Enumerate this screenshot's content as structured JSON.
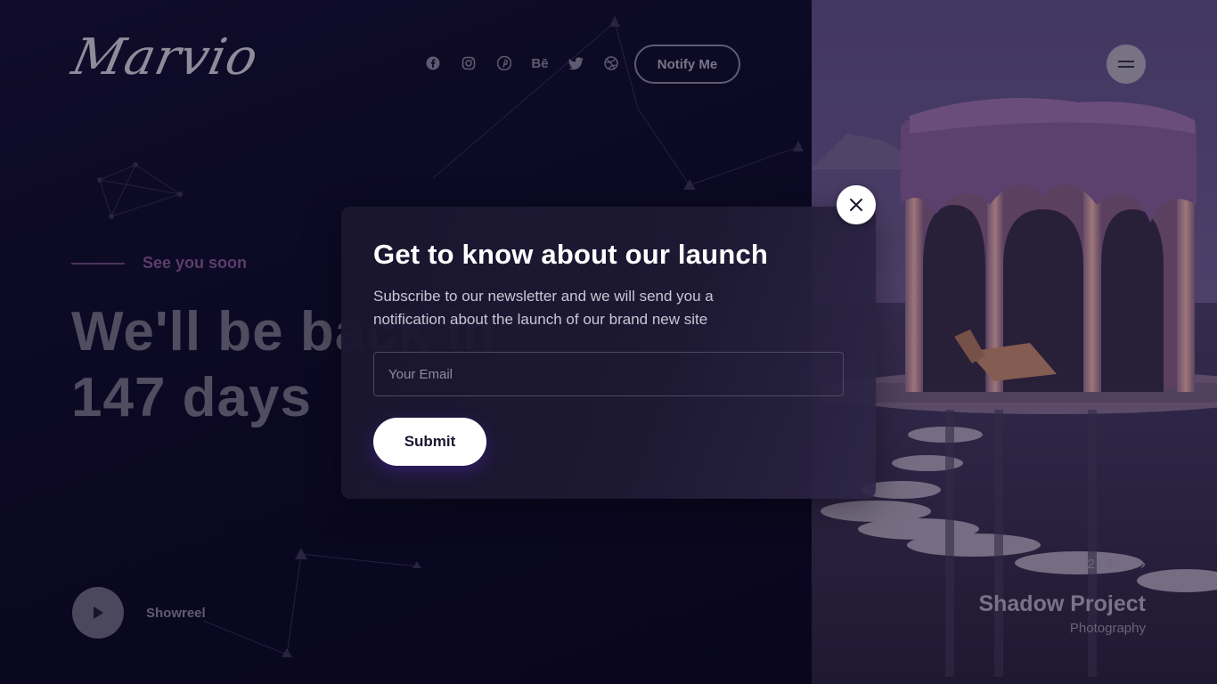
{
  "brand": {
    "logo_text": "Marvio"
  },
  "header": {
    "social_icons": [
      "facebook-icon",
      "instagram-icon",
      "pinterest-icon",
      "behance-icon",
      "twitter-icon",
      "dribbble-icon"
    ],
    "behance_glyph": "Bē",
    "notify_label": "Notify Me"
  },
  "hero": {
    "tagline": "See you soon",
    "headline_line1": "We'll be back in",
    "headline_line2": "147 days"
  },
  "showreel": {
    "label": "Showreel"
  },
  "slider": {
    "pager": "2 / 3",
    "project_title": "Shadow Project",
    "project_category": "Photography"
  },
  "modal": {
    "title": "Get to know about our launch",
    "description": "Subscribe to our newsletter and we will send you a notification about the launch of our brand new site",
    "email_placeholder": "Your Email",
    "submit_label": "Submit"
  },
  "colors": {
    "background": "#0b0820",
    "accent": "#6a4778",
    "button_bg": "#ffffff"
  }
}
